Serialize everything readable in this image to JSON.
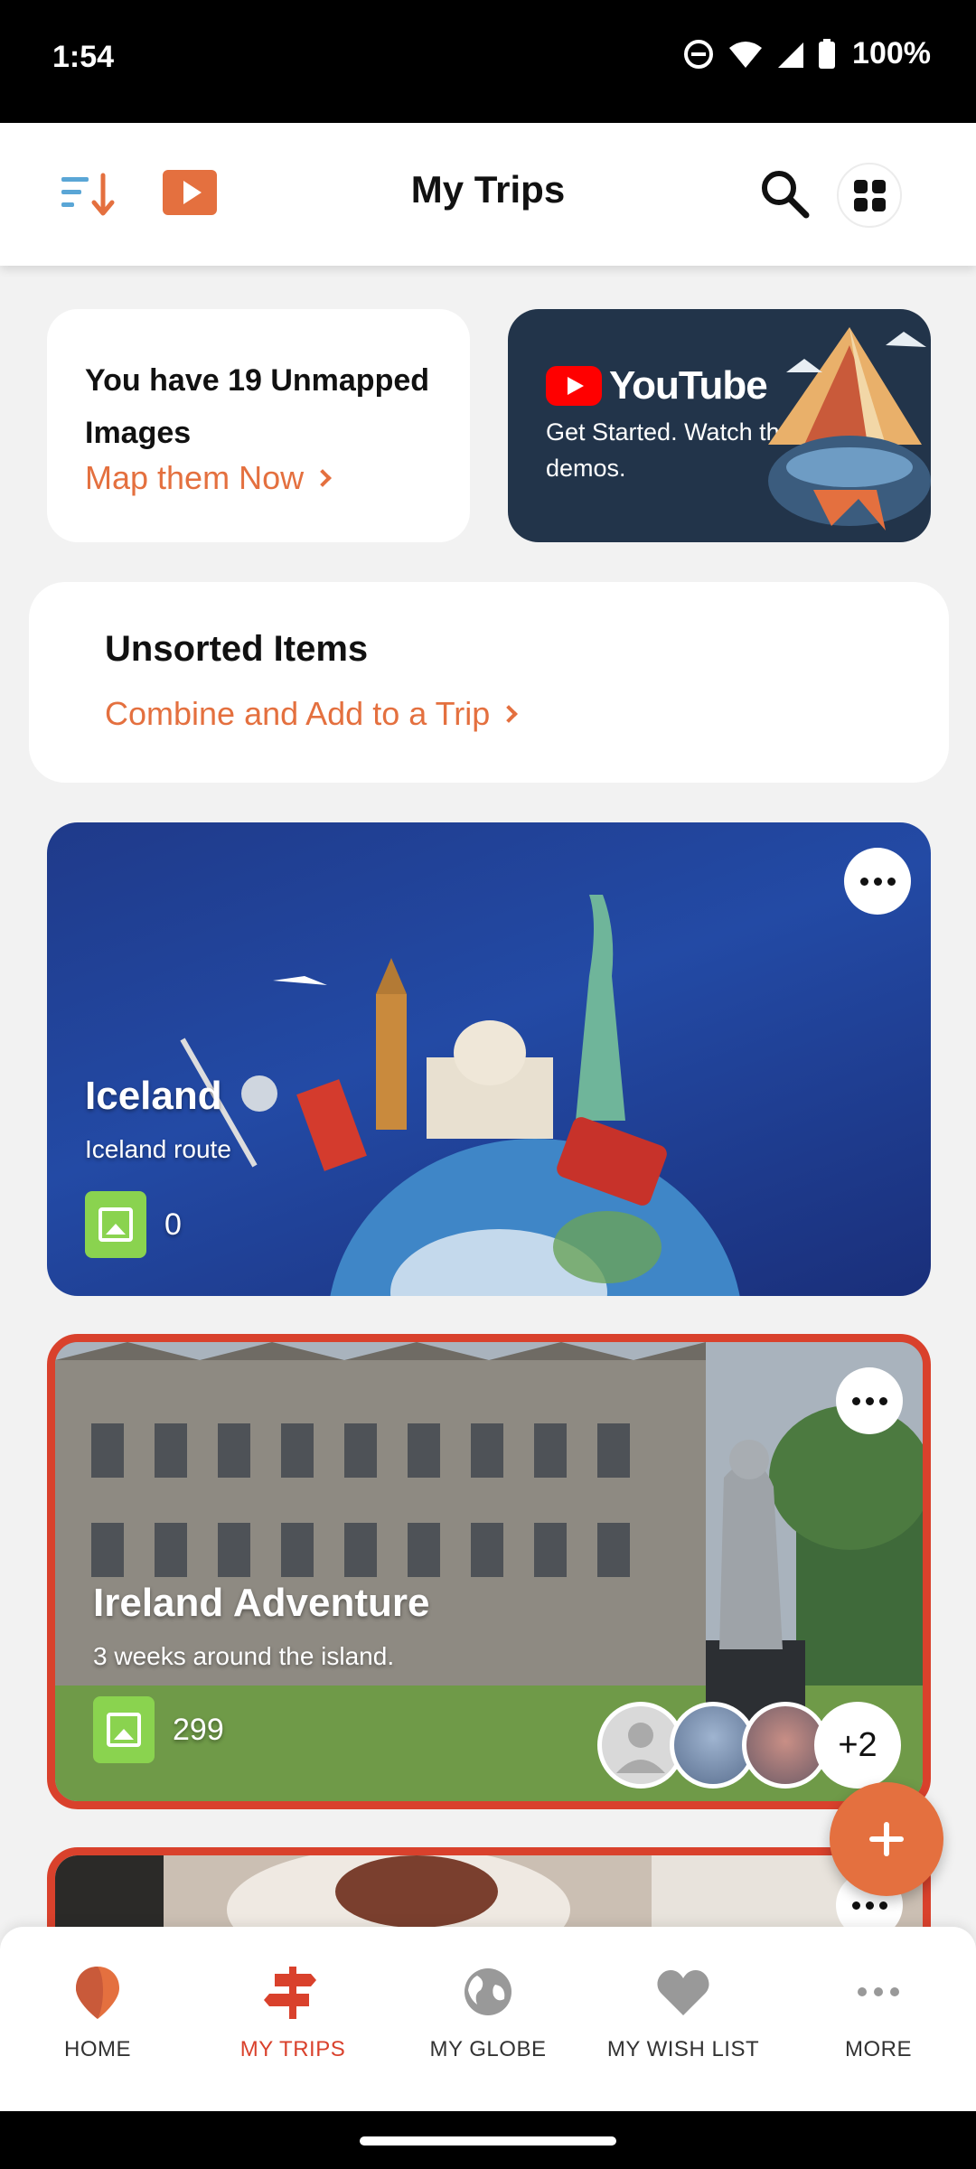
{
  "status_bar": {
    "time": "1:54",
    "battery": "100%"
  },
  "app_bar": {
    "title": "My Trips"
  },
  "unmapped": {
    "title": "You have 19 Unmapped Images",
    "link": "Map them Now"
  },
  "youtube": {
    "brand": "YouTube",
    "text": "Get Started. Watch the demos."
  },
  "unsorted": {
    "title": "Unsorted Items",
    "link": "Combine and Add to a Trip"
  },
  "trips": [
    {
      "name": "Iceland",
      "subtitle": "Iceland route",
      "photos": "0"
    },
    {
      "name": "Ireland Adventure",
      "subtitle": "3 weeks around the island.",
      "photos": "299",
      "extra_members": "+2"
    }
  ],
  "nav": [
    {
      "label": "HOME",
      "icon": "map-pin-icon"
    },
    {
      "label": "MY TRIPS",
      "icon": "signpost-icon",
      "active": true
    },
    {
      "label": "MY GLOBE",
      "icon": "globe-icon"
    },
    {
      "label": "MY WISH LIST",
      "icon": "heart-icon"
    },
    {
      "label": "MORE",
      "icon": "more-dots-icon"
    }
  ],
  "colors": {
    "accent": "#e4703f",
    "active_red": "#d9412c",
    "photo_badge": "#8ad34f",
    "yt_card_bg": "#22344a"
  }
}
